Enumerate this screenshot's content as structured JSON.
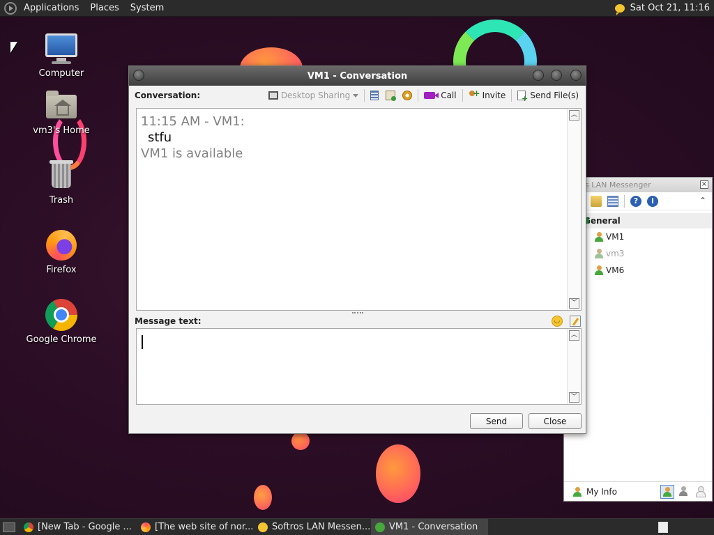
{
  "top_panel": {
    "menus": [
      "Applications",
      "Places",
      "System"
    ],
    "clock": "Sat Oct 21, 11:16"
  },
  "desktop_icons": [
    {
      "label": "Computer",
      "icon": "computer-icon"
    },
    {
      "label": "vm3's Home",
      "icon": "home-folder-icon"
    },
    {
      "label": "Trash",
      "icon": "trash-icon"
    },
    {
      "label": "Firefox",
      "icon": "firefox-icon"
    },
    {
      "label": "Google Chrome",
      "icon": "chrome-icon"
    }
  ],
  "conversation": {
    "title": "VM1 - Conversation",
    "conversation_label": "Conversation:",
    "toolbar": {
      "desktop_sharing": "Desktop Sharing",
      "call": "Call",
      "invite": "Invite",
      "send_files": "Send File(s)"
    },
    "messages": {
      "header": "11:15 AM - VM1:",
      "text": "stfu",
      "status": "VM1 is available"
    },
    "message_label": "Message text:",
    "message_value": "",
    "send_button": "Send",
    "close_button": "Close"
  },
  "lan_messenger": {
    "title": "Softros LAN Messenger",
    "title_visible": "s LAN Messenger",
    "close": "×",
    "group": "General",
    "contacts": [
      {
        "name": "VM1",
        "status": "online"
      },
      {
        "name": "vm3",
        "status": "offline"
      },
      {
        "name": "VM6",
        "status": "online"
      }
    ],
    "my_info": "My Info"
  },
  "taskbar": {
    "tasks": [
      {
        "label": "[New Tab - Google ...",
        "icon": "chrome-icon"
      },
      {
        "label": "[The web site of nor...",
        "icon": "firefox-icon"
      },
      {
        "label": "Softros LAN Messen...",
        "icon": "lan-messenger-icon"
      },
      {
        "label": "VM1 - Conversation",
        "icon": "user-icon"
      }
    ]
  }
}
